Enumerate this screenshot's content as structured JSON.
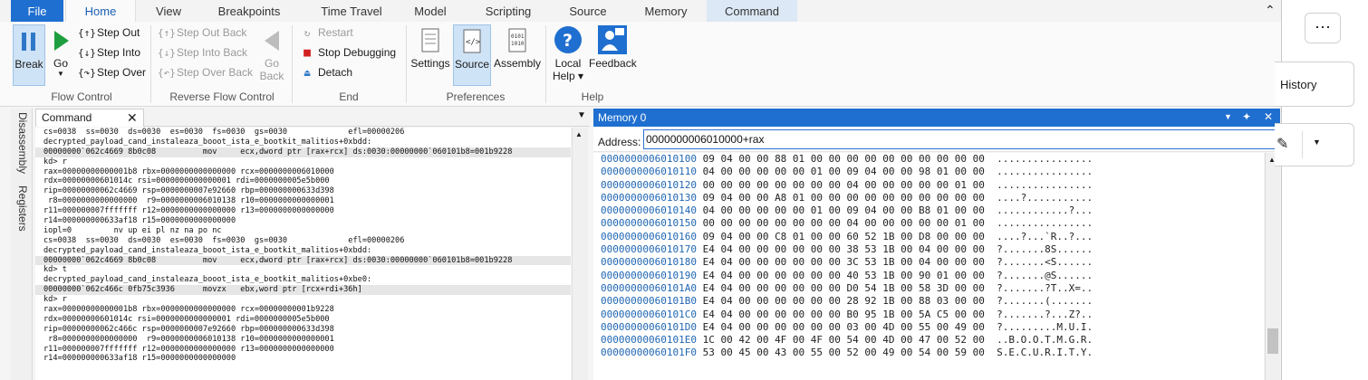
{
  "ribbon_tabs": [
    "File",
    "Home",
    "View",
    "Breakpoints",
    "Time Travel",
    "Model",
    "Scripting",
    "Source",
    "Memory",
    "Command"
  ],
  "flow_control": {
    "break": "Break",
    "go": "Go",
    "step_out": "Step Out",
    "step_into": "Step Into",
    "step_over": "Step Over",
    "label": "Flow Control"
  },
  "reverse_flow": {
    "step_out_back": "Step Out Back",
    "step_into_back": "Step Into Back",
    "step_over_back": "Step Over Back",
    "go_back_1": "Go",
    "go_back_2": "Back",
    "label": "Reverse Flow Control"
  },
  "end_group": {
    "restart": "Restart",
    "stop": "Stop Debugging",
    "detach": "Detach",
    "label": "End"
  },
  "preferences": {
    "settings": "Settings",
    "source": "Source",
    "assembly": "Assembly",
    "label": "Preferences"
  },
  "help_group": {
    "local_help_1": "Local",
    "local_help_2": "Help",
    "feedback": "Feedback",
    "label": "Help"
  },
  "side_tabs": {
    "disassembly": "Disassembly",
    "registers": "Registers"
  },
  "command_pane": {
    "title": "Command",
    "lines": [
      "cs=0038  ss=0030  ds=0030  es=0030  fs=0030  gs=0030             efl=00000206",
      "decrypted_payload_cand_instaleaza_booot_ista_e_bootkit_malitios+0xbdd:",
      "00000000`062c4669 8b0c08          mov     ecx,dword ptr [rax+rcx] ds:0030:00000000`060101b8=001b9228",
      "kd> r",
      "rax=00000000000001b8 rbx=0000000000000000 rcx=0000000006010000",
      "rdx=00000000601014c rsi=0000000000000001 rdi=0000000005e5b000",
      "rip=00000000062c4669 rsp=0000000007e92660 rbp=000000000633d398",
      " r8=0000000000000000  r9=0000000006010138 r10=0000000000000001",
      "r11=000000007fffffff r12=0000000000000000 r13=0000000000000000",
      "r14=000000000633af18 r15=0000000000000000",
      "iopl=0         nv up ei pl nz na po nc",
      "cs=0038  ss=0030  ds=0030  es=0030  fs=0030  gs=0030             efl=00000206",
      "decrypted_payload_cand_instaleaza_booot_ista_e_bootkit_malitios+0xbdd:",
      "00000000`062c4669 8b0c08          mov     ecx,dword ptr [rax+rcx] ds:0030:00000000`060101b8=001b9228",
      "kd> t",
      "decrypted_payload_cand_instaleaza_booot_ista_e_bootkit_malitios+0xbe0:",
      "00000000`062c466c 0fb75c3936      movzx   ebx,word ptr [rcx+rdi+36h]",
      "kd> r",
      "rax=00000000000001b8 rbx=0000000000000000 rcx=00000000001b9228",
      "rdx=00000000601014c rsi=0000000000000001 rdi=0000000005e5b000",
      "rip=00000000062c466c rsp=0000000007e92660 rbp=000000000633d398",
      " r8=0000000000000000  r9=0000000006010138 r10=0000000000000001",
      "r11=000000007fffffff r12=0000000000000000 r13=0000000000000000",
      "r14=000000000633af18 r15=0000000000000000"
    ]
  },
  "memory_pane": {
    "title": "Memory 0",
    "address_label": "Address:",
    "address_value": "0000000006010000+rax",
    "rows": [
      {
        "addr": "0000000006010100",
        "bytes": "09 04 00 00 88 01 00 00 00 00 00 00 00 00 00 00",
        "ascii": "................"
      },
      {
        "addr": "0000000006010110",
        "bytes": "04 00 00 00 00 00 01 00 09 04 00 00 98 01 00 00",
        "ascii": "................"
      },
      {
        "addr": "0000000006010120",
        "bytes": "00 00 00 00 00 00 00 00 04 00 00 00 00 00 01 00",
        "ascii": "................"
      },
      {
        "addr": "0000000006010130",
        "bytes": "09 04 00 00 A8 01 00 00 00 00 00 00 00 00 00 00",
        "ascii": "....?..........."
      },
      {
        "addr": "0000000006010140",
        "bytes": "04 00 00 00 00 00 01 00 09 04 00 00 B8 01 00 00",
        "ascii": "............?..."
      },
      {
        "addr": "0000000006010150",
        "bytes": "00 00 00 00 00 00 00 00 04 00 00 00 00 00 01 00",
        "ascii": "................"
      },
      {
        "addr": "0000000006010160",
        "bytes": "09 04 00 00 C8 01 00 00 60 52 1B 00 D8 00 00 00",
        "ascii": "....?...`R..?..."
      },
      {
        "addr": "0000000006010170",
        "bytes": "E4 04 00 00 00 00 00 00 38 53 1B 00 04 00 00 00",
        "ascii": "?.......8S......"
      },
      {
        "addr": "0000000006010180",
        "bytes": "E4 04 00 00 00 00 00 00 3C 53 1B 00 04 00 00 00",
        "ascii": "?.......<S......"
      },
      {
        "addr": "0000000006010190",
        "bytes": "E4 04 00 00 00 00 00 00 40 53 1B 00 90 01 00 00",
        "ascii": "?.......@S......"
      },
      {
        "addr": "00000000060101A0",
        "bytes": "E4 04 00 00 00 00 00 00 D0 54 1B 00 58 3D 00 00",
        "ascii": "?.......?T..X=.."
      },
      {
        "addr": "00000000060101B0",
        "bytes": "E4 04 00 00 00 00 00 00 28 92 1B 00 88 03 00 00",
        "ascii": "?.......(......."
      },
      {
        "addr": "00000000060101C0",
        "bytes": "E4 04 00 00 00 00 00 00 B0 95 1B 00 5A C5 00 00",
        "ascii": "?.......?...Z?.."
      },
      {
        "addr": "00000000060101D0",
        "bytes": "E4 04 00 00 00 00 00 00 03 00 4D 00 55 00 49 00",
        "ascii": "?.........M.U.I."
      },
      {
        "addr": "00000000060101E0",
        "bytes": "1C 00 42 00 4F 00 4F 00 54 00 4D 00 47 00 52 00",
        "ascii": "..B.O.O.T.M.G.R."
      },
      {
        "addr": "00000000060101F0",
        "bytes": "53 00 45 00 43 00 55 00 52 00 49 00 54 00 59 00",
        "ascii": "S.E.C.U.R.I.T.Y."
      }
    ]
  },
  "background_window": {
    "history_label": "History"
  },
  "colors": {
    "accent": "#1f6fd0",
    "address_blue": "#1f66b3"
  }
}
